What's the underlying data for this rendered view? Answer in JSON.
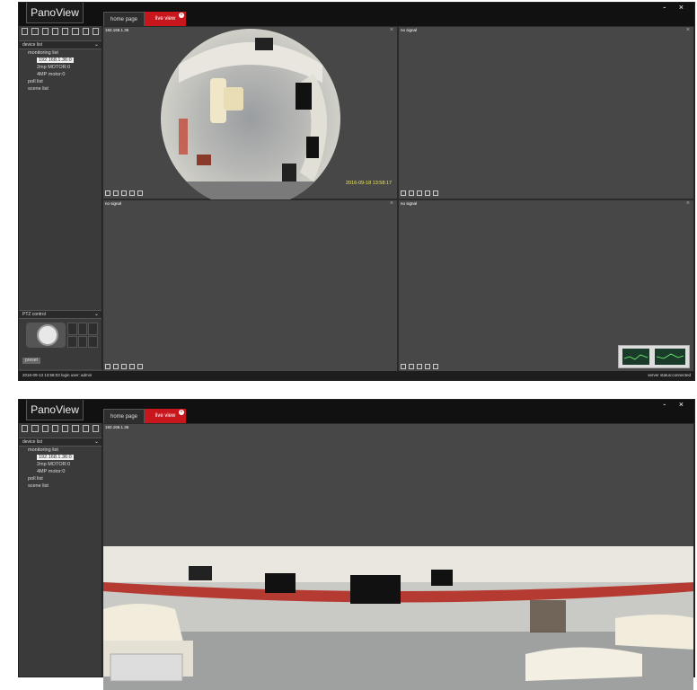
{
  "app": {
    "logo": "PanoView"
  },
  "tabs": [
    {
      "label": "home page"
    },
    {
      "label": "live view"
    }
  ],
  "window_controls": "- ×",
  "sidebar": {
    "device_panel_title": "device list",
    "tree": [
      {
        "label": "monitoring list"
      },
      {
        "label": "192.168.1.36:0"
      },
      {
        "label": "2mp MOTOR:0"
      },
      {
        "label": "4MP motor:0"
      },
      {
        "label": "poll list"
      },
      {
        "label": "scene list"
      }
    ],
    "ptz_title": "PTZ control",
    "preset_label": "preset"
  },
  "cells": [
    {
      "title": "192.168.1.36"
    },
    {
      "title": "no signal"
    },
    {
      "title": "no signal"
    },
    {
      "title": "no signal"
    }
  ],
  "timestamp": "2016-09-18 13:58:17",
  "statusbar": {
    "left": "2016-09-13 13:58:03   login user: admin",
    "right": "server status:connected"
  },
  "pano_cell_title": "192.168.1.36",
  "colors": {
    "accent": "#c8161d",
    "background": "#454545"
  }
}
